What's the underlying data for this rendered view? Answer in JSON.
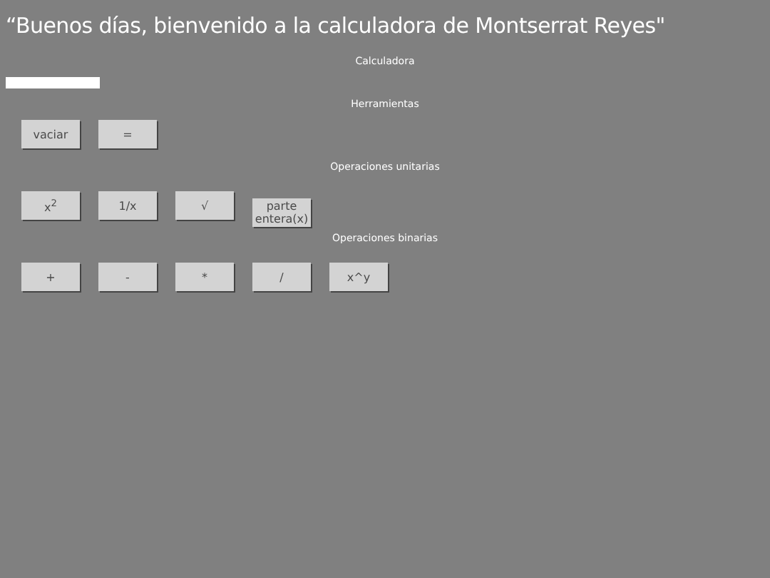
{
  "title": "“Buenos días, bienvenido a la calculadora de Montserrat Reyes\"",
  "subtitle": "Calculadora",
  "sections": [
    {
      "heading": "Herramientas",
      "buttons": [
        {
          "label": "vaciar"
        },
        {
          "label": "="
        }
      ]
    },
    {
      "heading": "Operaciones unitarias",
      "buttons": [
        {
          "label": "x$^{2}$"
        },
        {
          "label": "1/x"
        },
        {
          "label": "√"
        },
        {
          "label": "parte entera(x)"
        }
      ]
    },
    {
      "heading": "Operaciones binarias",
      "buttons": [
        {
          "label": "+"
        },
        {
          "label": "-"
        },
        {
          "label": "*"
        },
        {
          "label": "/"
        },
        {
          "label": "x^y"
        }
      ]
    }
  ]
}
